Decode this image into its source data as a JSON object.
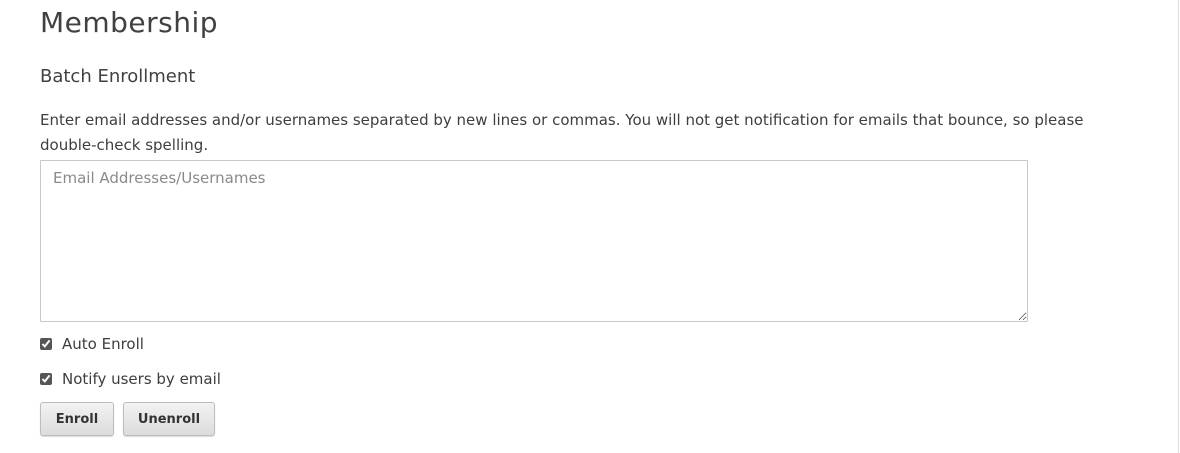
{
  "page": {
    "title": "Membership"
  },
  "batch_enrollment": {
    "heading": "Batch Enrollment",
    "instructions": "Enter email addresses and/or usernames separated by new lines or commas. You will not get notification for emails that bounce, so please double-check spelling.",
    "identifiers_placeholder": "Email Addresses/Usernames",
    "identifiers_value": "",
    "auto_enroll_label": "Auto Enroll",
    "auto_enroll_checked": true,
    "notify_label": "Notify users by email",
    "notify_checked": true,
    "enroll_button": "Enroll",
    "unenroll_button": "Unenroll"
  }
}
